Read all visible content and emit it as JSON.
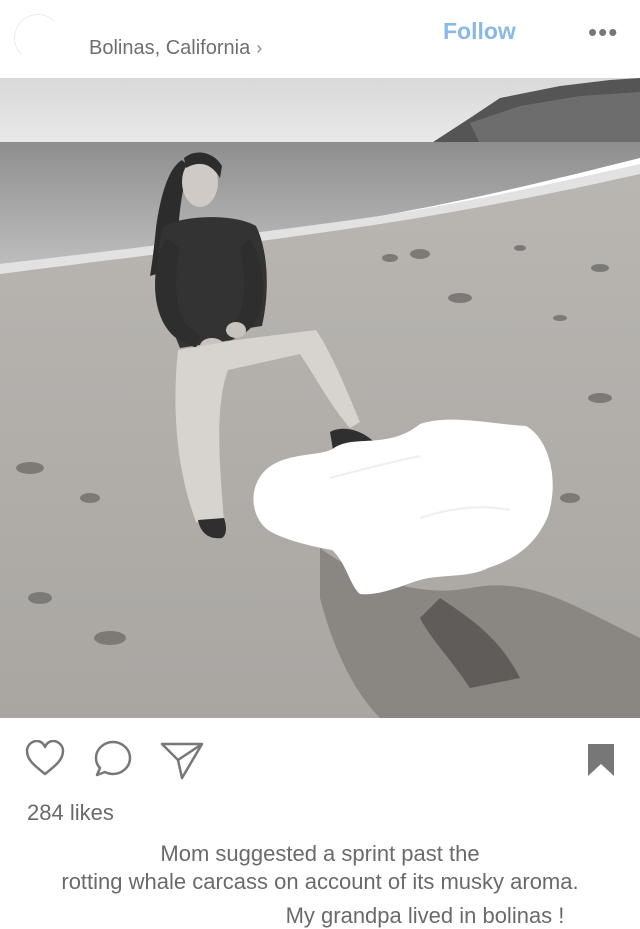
{
  "header": {
    "location": "Bolinas, California",
    "follow_label": "Follow",
    "more_glyph": "•••"
  },
  "photo": {
    "description_icon": "photo-icon"
  },
  "actions": {
    "like_icon": "heart-outline-icon",
    "comment_icon": "speech-bubble-icon",
    "share_icon": "paper-plane-icon",
    "save_icon": "bookmark-filled-icon"
  },
  "post": {
    "likes": "284 likes",
    "caption_line1": "Mom suggested a sprint past the",
    "caption_line2": "rotting whale carcass on account of its musky aroma.",
    "comment": "My grandpa lived in bolinas !"
  },
  "colors": {
    "follow": "#8ab8e8",
    "text": "#6a6a6a",
    "icons": "#777777"
  }
}
